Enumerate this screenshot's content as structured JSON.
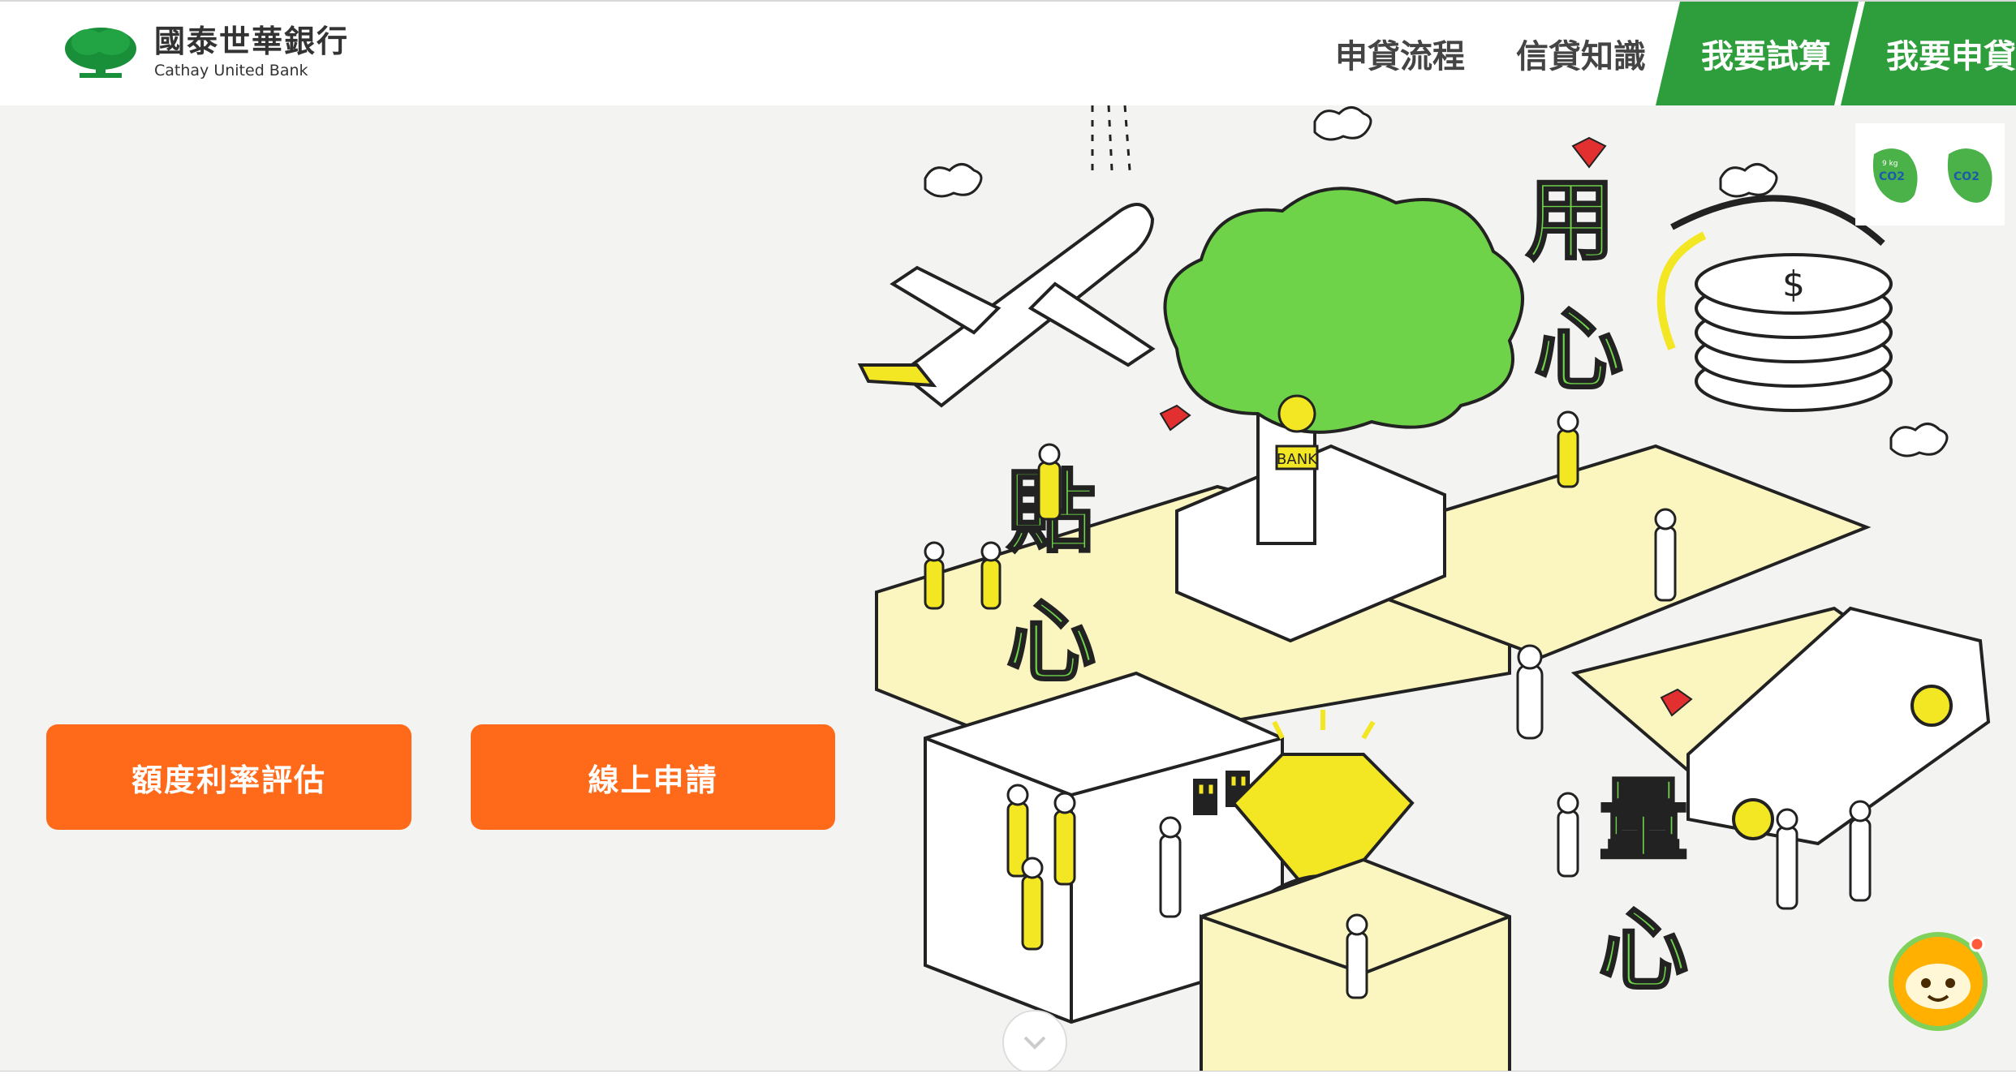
{
  "brand": {
    "name_zh": "國泰世華銀行",
    "name_en": "Cathay United Bank"
  },
  "nav": {
    "items": [
      {
        "label": "申貸流程"
      },
      {
        "label": "信貸知識"
      },
      {
        "label": "我要試算"
      },
      {
        "label": "我要申貸"
      }
    ]
  },
  "hero": {
    "buttons": {
      "eval": "額度利率評估",
      "online": "線上申請"
    },
    "illustration_words": [
      "用心",
      "貼心",
      "量心"
    ],
    "bank_sign": "BANK"
  },
  "eco_badges": [
    {
      "label": "CO2",
      "weight": "9 kg"
    },
    {
      "label": "CO2"
    }
  ],
  "colors": {
    "brand_green": "#2e9e3c",
    "accent_orange": "#ff6a1a",
    "illus_green": "#6fd34a",
    "illus_yellow": "#f3e623"
  }
}
